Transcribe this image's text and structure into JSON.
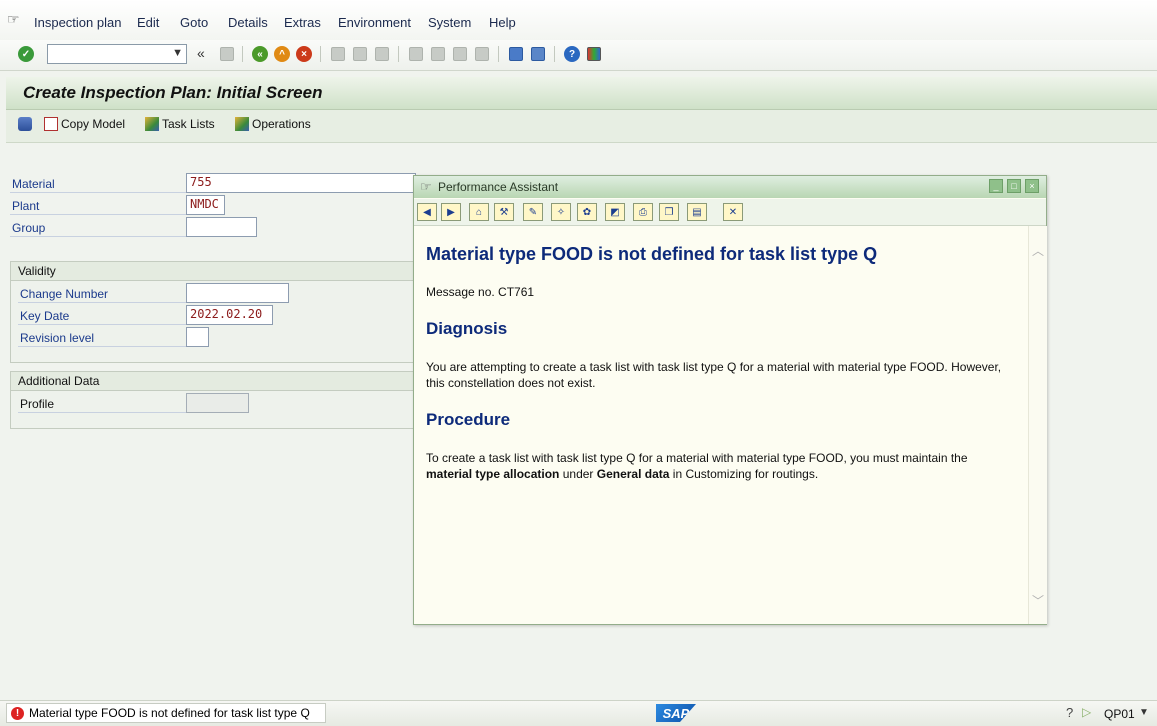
{
  "menu": {
    "items": [
      {
        "label": "Inspection plan"
      },
      {
        "label": "Edit"
      },
      {
        "label": "Goto"
      },
      {
        "label": "Details"
      },
      {
        "label": "Extras"
      },
      {
        "label": "Environment"
      },
      {
        "label": "System"
      },
      {
        "label": "Help"
      }
    ]
  },
  "toolbar": {
    "command_field_value": "",
    "collapse_label": "«"
  },
  "title": "Create Inspection Plan: Initial Screen",
  "app_toolbar": {
    "copy_model": "Copy Model",
    "task_lists": "Task Lists",
    "operations": "Operations"
  },
  "form": {
    "material_label": "Material",
    "material_value": "755",
    "plant_label": "Plant",
    "plant_value": "NMDC",
    "group_label": "Group",
    "group_value": "",
    "validity_header": "Validity",
    "change_number_label": "Change Number",
    "change_number_value": "",
    "key_date_label": "Key Date",
    "key_date_value": "2022.02.20",
    "revision_label": "Revision level",
    "revision_value": "",
    "additional_header": "Additional Data",
    "profile_label": "Profile",
    "profile_value": ""
  },
  "popup": {
    "title": "Performance Assistant",
    "heading": "Material type FOOD is not defined for task list type Q",
    "message_no": "Message no. CT761",
    "diagnosis_heading": "Diagnosis",
    "diagnosis_text": "You are attempting to create a task list with task list type Q for a material with material type FOOD. However, this constellation does not exist.",
    "procedure_heading": "Procedure",
    "procedure_text_1": "To create a task list with task list type Q for a material with material type FOOD, you must maintain the ",
    "procedure_bold_1": "material type allocation",
    "procedure_text_2": " under ",
    "procedure_bold_2": "General data",
    "procedure_text_3": " in Customizing for routings."
  },
  "status": {
    "message": "Material type FOOD is not defined for task list type Q",
    "tcode": "QP01"
  },
  "colors": {
    "accent": "#0d2a7a",
    "error": "#dd2222",
    "title_bg": "#cfe1c8"
  }
}
